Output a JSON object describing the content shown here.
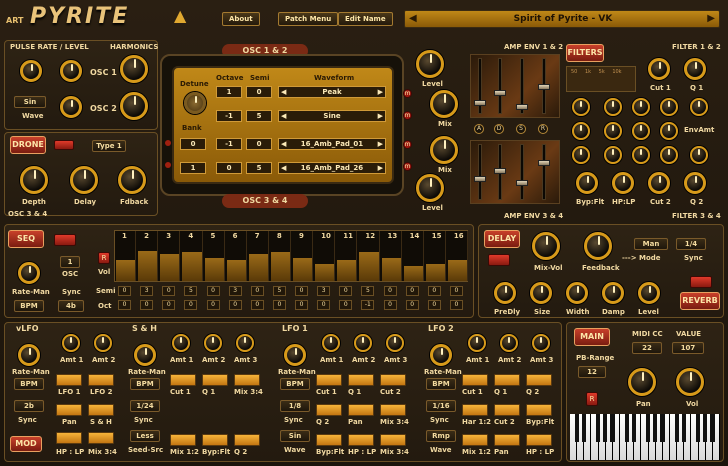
{
  "header": {
    "logo_small": "ART",
    "logo_big": "PYRITE",
    "about": "About",
    "patch_menu": "Patch Menu",
    "edit_name": "Edit Name",
    "patch_name": "Spirit of Pyrite - VK",
    "prev": "◀",
    "next": "▶"
  },
  "osc": {
    "pulse_rate_level": "PULSE RATE / LEVEL",
    "harmonics": "HARMONICS",
    "osc1": "OSC 1",
    "osc2": "OSC 2",
    "sin": "Sin",
    "wave": "Wave",
    "title12": "OSC 1 & 2",
    "title34": "OSC 3 & 4",
    "detune": "Detune",
    "bank": "Bank",
    "octave": "Octave",
    "semi": "Semi",
    "waveform": "Waveform",
    "rows": [
      {
        "oct": "1",
        "semi": "0",
        "wave": "Peak"
      },
      {
        "oct": "-1",
        "semi": "5",
        "wave": "Sine"
      },
      {
        "bank": "0",
        "oct": "-1",
        "semi": "0",
        "wave": "16_Amb_Pad_01"
      },
      {
        "bank": "1",
        "oct": "0",
        "semi": "5",
        "wave": "16_Amb_Pad_26"
      }
    ],
    "level": "Level",
    "mix": "Mix",
    "m": "m",
    "osc34": "OSC 3 & 4"
  },
  "amp": {
    "env12": "AMP ENV 1 & 2",
    "env34": "AMP ENV 3 & 4",
    "a": "A",
    "d": "D",
    "s": "S",
    "r": "R"
  },
  "filters": {
    "title": "FILTERS",
    "f12": "FILTER 1 & 2",
    "f34": "FILTER 3 & 4",
    "cut1": "Cut 1",
    "q1": "Q 1",
    "envamt": "EnvAmt",
    "bypflt": "Byp:Flt",
    "hplp": "HP:LP",
    "cut2": "Cut 2",
    "q2": "Q 2",
    "graph_ticks": [
      "50",
      "1k",
      "5k",
      "10k"
    ]
  },
  "drone": {
    "title": "DRONE",
    "type": "Type 1",
    "depth": "Depth",
    "delay": "Delay",
    "fdback": "Fdback"
  },
  "seq": {
    "title": "SEQ",
    "steps": [
      "1",
      "2",
      "3",
      "4",
      "5",
      "6",
      "7",
      "8",
      "9",
      "10",
      "11",
      "12",
      "13",
      "14",
      "15",
      "16"
    ],
    "step_levels": [
      0.55,
      0.8,
      0.7,
      0.75,
      0.6,
      0.55,
      0.7,
      0.75,
      0.6,
      0.45,
      0.55,
      0.75,
      0.6,
      0.4,
      0.45,
      0.55
    ],
    "semi": [
      "0",
      "3",
      "0",
      "5",
      "0",
      "3",
      "0",
      "5",
      "0",
      "3",
      "0",
      "5",
      "0",
      "0",
      "0",
      "0"
    ],
    "oct": [
      "0",
      "0",
      "0",
      "0",
      "0",
      "0",
      "0",
      "0",
      "0",
      "0",
      "0",
      "-1",
      "0",
      "0",
      "0",
      "0"
    ],
    "osc": "OSC",
    "osc_val": "1",
    "sync": "Sync",
    "sync_val": "4b",
    "rate_man": "Rate-Man",
    "bpm": "BPM",
    "vol": "Vol",
    "semi_lbl": "Semi",
    "oct_lbl": "Oct",
    "r": "R"
  },
  "delay": {
    "title": "DELAY",
    "mixvol": "Mix-Vol",
    "feedback": "Feedback",
    "mode_arrow": "---> Mode",
    "mode": "Man",
    "sync": "Sync",
    "sync_val": "1/4"
  },
  "reverb": {
    "title": "REVERB",
    "predly": "PreDly",
    "size": "Size",
    "width": "Width",
    "damp": "Damp",
    "level": "Level"
  },
  "mod": {
    "vlfo": "vLFO",
    "sh": "S & H",
    "lfo1": "LFO 1",
    "lfo2": "LFO 2",
    "mod": "MOD",
    "amt1": "Amt 1",
    "amt2": "Amt 2",
    "amt3": "Amt 3",
    "rate_man": "Rate-Man",
    "bpm": "BPM",
    "sync": "Sync",
    "vlfo_vals": {
      "sync": "2b",
      "t1": "LFO 1",
      "t2": "LFO 2",
      "pan": "Pan",
      "sh": "S & H",
      "hp": "HP : LP",
      "mix": "Mix 3:4"
    },
    "sh_vals": {
      "sync": "1/24",
      "less": "Less",
      "seed": "Seed-Src",
      "t1": "Cut 1",
      "t2": "Q 1",
      "t3": "Mix 3:4",
      "b1": "Mix 1:2",
      "b2": "Byp:Flt",
      "b3": "Q 2"
    },
    "lfo1_vals": {
      "sync": "1/8",
      "sin": "Sin",
      "wave": "Wave",
      "t1": "Cut 1",
      "t2": "Q 1",
      "t3": "Cut 2",
      "m1": "Q 2",
      "m2": "Pan",
      "m3": "Mix 3:4",
      "b1": "Byp:Flt",
      "b2": "HP : LP",
      "b3": "Mix 3:4"
    },
    "lfo2_vals": {
      "sync": "1/16",
      "rmp": "Rmp",
      "wave": "Wave",
      "t1": "Cut 1",
      "t2": "Q 1",
      "t3": "Q 2",
      "m1": "Har 1:2",
      "m2": "Cut 2",
      "m3": "Byp:Flt",
      "b1": "Mix 1:2",
      "b2": "Pan",
      "b3": "HP : LP"
    }
  },
  "main": {
    "title": "MAIN",
    "midicc": "MIDI CC",
    "value": "VALUE",
    "cc": "22",
    "val": "107",
    "pb": "PB-Range",
    "pb_val": "12",
    "pan": "Pan",
    "vol": "Vol",
    "r": "R"
  }
}
